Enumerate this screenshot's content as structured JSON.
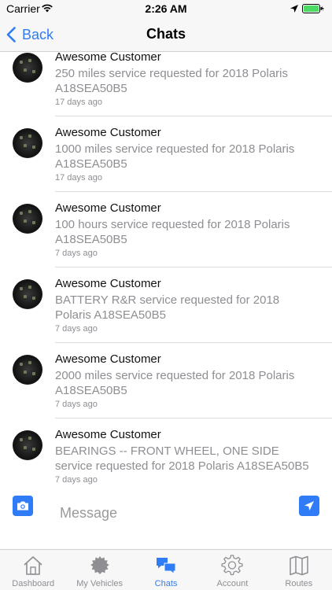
{
  "status_bar": {
    "carrier": "Carrier",
    "time": "2:26 AM"
  },
  "nav": {
    "back_label": "Back",
    "title": "Chats"
  },
  "chats": [
    {
      "name": "Awesome Customer",
      "message": "250 miles service requested for 2018 Polaris A18SEA50B5",
      "time": "17 days ago"
    },
    {
      "name": "Awesome Customer",
      "message": "1000 miles service requested for 2018 Polaris A18SEA50B5",
      "time": "17 days ago"
    },
    {
      "name": "Awesome Customer",
      "message": "100 hours service requested for 2018 Polaris A18SEA50B5",
      "time": "7 days ago"
    },
    {
      "name": "Awesome Customer",
      "message": "BATTERY R&R service requested for 2018 Polaris A18SEA50B5",
      "time": "7 days ago"
    },
    {
      "name": "Awesome Customer",
      "message": "2000 miles service requested for 2018 Polaris A18SEA50B5",
      "time": "7 days ago"
    },
    {
      "name": "Awesome Customer",
      "message": "BEARINGS -- FRONT WHEEL, ONE SIDE service requested for 2018 Polaris A18SEA50B5",
      "time": "7 days ago"
    }
  ],
  "composer": {
    "placeholder": "Message",
    "value": ""
  },
  "tabs": [
    {
      "label": "Dashboard",
      "icon": "house-icon",
      "active": false
    },
    {
      "label": "My Vehicles",
      "icon": "gear-badge-icon",
      "active": false
    },
    {
      "label": "Chats",
      "icon": "chat-bubbles-icon",
      "active": true
    },
    {
      "label": "Account",
      "icon": "settings-gear-icon",
      "active": false
    },
    {
      "label": "Routes",
      "icon": "map-icon",
      "active": false
    }
  ],
  "colors": {
    "accent": "#2f7cf6",
    "inactive": "#8e8e93",
    "battery": "#4cd964"
  }
}
